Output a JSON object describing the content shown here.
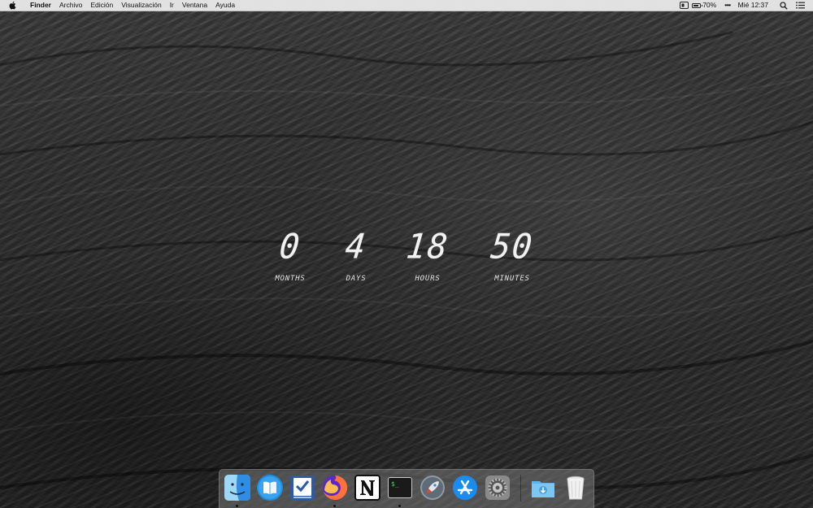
{
  "menubar": {
    "apple_icon": "apple-icon",
    "app_name": "Finder",
    "items": [
      "Archivo",
      "Edición",
      "Visualización",
      "Ir",
      "Ventana",
      "Ayuda"
    ],
    "battery_percent": "70%",
    "battery_level": 0.7,
    "clock": "Mié 12:37"
  },
  "countdown": {
    "months": {
      "value": "0",
      "label": "MONTHS"
    },
    "days": {
      "value": "4",
      "label": "DAYS"
    },
    "hours": {
      "value": "18",
      "label": "HOURS"
    },
    "minutes": {
      "value": "50",
      "label": "MINUTES"
    }
  },
  "dock": {
    "apps": [
      {
        "name": "finder",
        "icon": "finder-icon",
        "running": true
      },
      {
        "name": "readkit",
        "icon": "book-icon",
        "running": false
      },
      {
        "name": "tasks",
        "icon": "checklist-icon",
        "running": false
      },
      {
        "name": "firefox",
        "icon": "firefox-icon",
        "running": true
      },
      {
        "name": "notion",
        "icon": "notion-icon",
        "running": false
      },
      {
        "name": "terminal",
        "icon": "terminal-icon",
        "running": true
      },
      {
        "name": "launchpad",
        "icon": "rocket-icon",
        "running": false
      },
      {
        "name": "app-store",
        "icon": "app-store-icon",
        "running": false
      },
      {
        "name": "system-preferences",
        "icon": "gear-icon",
        "running": false
      }
    ],
    "downloads_icon": "downloads-folder-icon",
    "trash_icon": "trash-icon"
  }
}
